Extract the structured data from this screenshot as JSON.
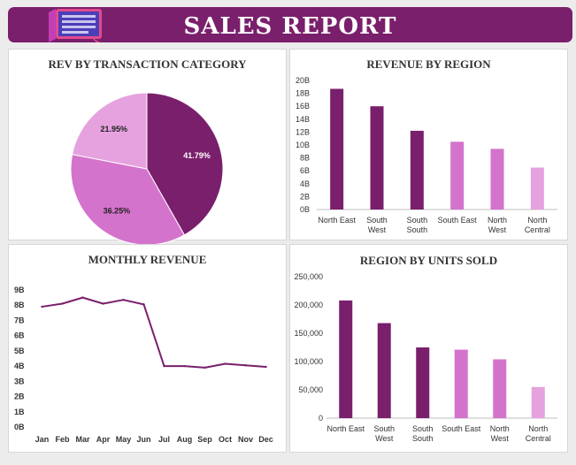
{
  "header": {
    "title": "SALES REPORT"
  },
  "colors": {
    "brand": "#7a1f6c",
    "dark": "#7a1f6c",
    "mid": "#d473cc",
    "light": "#e6a1df"
  },
  "chart_data": [
    {
      "type": "pie",
      "title": "REV BY TRANSACTION CATEGORY",
      "slices": [
        {
          "label": "41.79%",
          "value": 41.79,
          "color": "#7a1f6c",
          "label_color": "#ffffff"
        },
        {
          "label": "36.25%",
          "value": 36.25,
          "color": "#d473cc",
          "label_color": "#222222"
        },
        {
          "label": "21.95%",
          "value": 21.95,
          "color": "#e6a1df",
          "label_color": "#222222"
        }
      ]
    },
    {
      "type": "bar",
      "title": "REVENUE BY REGION",
      "categories": [
        [
          "North East"
        ],
        [
          "South",
          "West"
        ],
        [
          "South",
          "South"
        ],
        [
          "South East"
        ],
        [
          "North",
          "West"
        ],
        [
          "North",
          "Central"
        ]
      ],
      "values": [
        18.7,
        16.0,
        12.2,
        10.5,
        9.4,
        6.5
      ],
      "colors": [
        "#7a1f6c",
        "#7a1f6c",
        "#7a1f6c",
        "#d473cc",
        "#d473cc",
        "#e6a1df"
      ],
      "yticks": [
        "0B",
        "2B",
        "4B",
        "6B",
        "8B",
        "10B",
        "12B",
        "14B",
        "16B",
        "18B",
        "20B"
      ],
      "ylim": [
        0,
        20
      ]
    },
    {
      "type": "line",
      "title": "MONTHLY REVENUE",
      "categories": [
        "Jan",
        "Feb",
        "Mar",
        "Apr",
        "May",
        "Jun",
        "Jul",
        "Aug",
        "Sep",
        "Oct",
        "Nov",
        "Dec"
      ],
      "values": [
        7.9,
        8.1,
        8.5,
        8.1,
        8.35,
        8.05,
        4.0,
        4.0,
        3.9,
        4.15,
        4.05,
        3.95
      ],
      "color": "#7a1f6c",
      "yticks": [
        "0B",
        "1B",
        "2B",
        "3B",
        "4B",
        "5B",
        "6B",
        "7B",
        "8B",
        "9B"
      ],
      "ylim": [
        0,
        9
      ]
    },
    {
      "type": "bar",
      "title": "REGION BY UNITS SOLD",
      "categories": [
        [
          "North East"
        ],
        [
          "South",
          "West"
        ],
        [
          "South",
          "South"
        ],
        [
          "South East"
        ],
        [
          "North",
          "West"
        ],
        [
          "North",
          "Central"
        ]
      ],
      "values": [
        208000,
        168000,
        125000,
        121000,
        104000,
        55000
      ],
      "colors": [
        "#7a1f6c",
        "#7a1f6c",
        "#7a1f6c",
        "#d473cc",
        "#d473cc",
        "#e6a1df"
      ],
      "yticks": [
        "0",
        "50,000",
        "100,000",
        "150,000",
        "200,000",
        "250,000"
      ],
      "ylim": [
        0,
        250000
      ]
    }
  ]
}
